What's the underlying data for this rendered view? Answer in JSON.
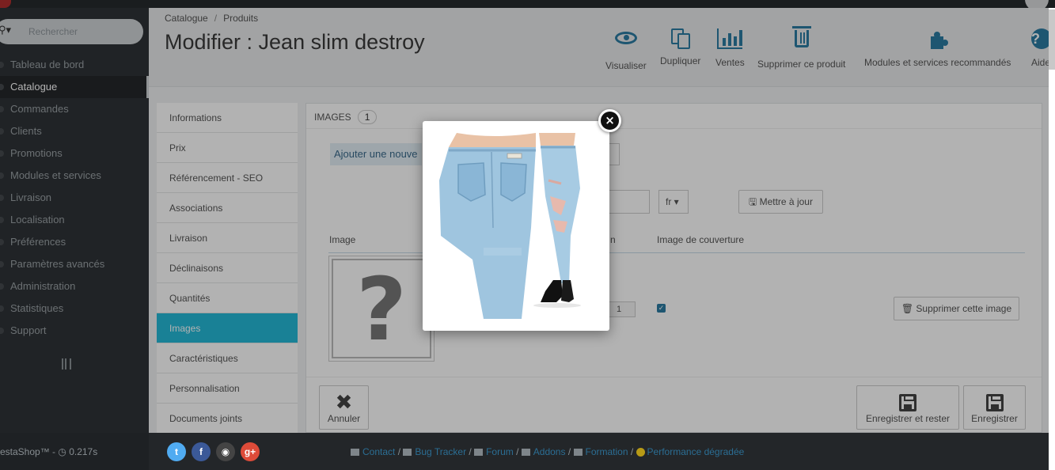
{
  "sidebar": {
    "search_placeholder": "Rechercher",
    "items": [
      {
        "label": "Tableau de bord"
      },
      {
        "label": "Catalogue",
        "active": true
      },
      {
        "label": "Commandes"
      },
      {
        "label": "Clients"
      },
      {
        "label": "Promotions"
      },
      {
        "label": "Modules et services"
      },
      {
        "label": "Livraison"
      },
      {
        "label": "Localisation"
      },
      {
        "label": "Préférences"
      },
      {
        "label": "Paramètres avancés"
      },
      {
        "label": "Administration"
      },
      {
        "label": "Statistiques"
      },
      {
        "label": "Support"
      }
    ]
  },
  "header": {
    "breadcrumb": [
      "Catalogue",
      "Produits"
    ],
    "breadcrumb_sep": "/",
    "title": "Modifier : Jean slim destroy",
    "toolbar": [
      {
        "label": "Visualiser",
        "icon": "eye-icon"
      },
      {
        "label": "Dupliquer",
        "icon": "copy-icon"
      },
      {
        "label": "Ventes",
        "icon": "bar-chart-icon"
      },
      {
        "label": "Supprimer ce produit",
        "icon": "trash-icon"
      },
      {
        "label": "Modules et services recommandés",
        "icon": "puzzle-icon"
      },
      {
        "label": "Aide",
        "icon": "help-icon"
      }
    ]
  },
  "tabs": [
    {
      "label": "Informations"
    },
    {
      "label": "Prix"
    },
    {
      "label": "Référencement - SEO"
    },
    {
      "label": "Associations"
    },
    {
      "label": "Livraison"
    },
    {
      "label": "Déclinaisons"
    },
    {
      "label": "Quantités"
    },
    {
      "label": "Images",
      "active": true
    },
    {
      "label": "Caractéristiques"
    },
    {
      "label": "Personnalisation"
    },
    {
      "label": "Documents joints"
    }
  ],
  "images_panel": {
    "heading": "Images",
    "count": "1",
    "add_button": "Ajouter une nouve",
    "language": "fr",
    "update_button": "Mettre à jour",
    "col_image": "Image",
    "col_position": "n",
    "col_cover": "Image de couverture",
    "placeholder_glyph": "?",
    "row_position": "1",
    "cover_checked": true,
    "delete_image_button": "Supprimer cette image",
    "cancel_button": "Annuler",
    "save_stay_button": "Enregistrer et rester",
    "save_button": "Enregistrer"
  },
  "modal": {
    "close_glyph": "×"
  },
  "footer": {
    "brand": "estaShop™ - ",
    "timing": "0.217s",
    "links": [
      {
        "label": "Contact",
        "sep": " / "
      },
      {
        "label": "Bug Tracker",
        "sep": " / "
      },
      {
        "label": "Forum",
        "sep": " / "
      },
      {
        "label": "Addons",
        "sep": " / "
      },
      {
        "label": "Formation",
        "sep": " / "
      },
      {
        "label": "Performance dégradée",
        "sep": ""
      }
    ],
    "social": [
      {
        "name": "twitter-icon",
        "glyph": "t",
        "color": "#50abf1"
      },
      {
        "name": "facebook-icon",
        "glyph": "f",
        "color": "#3b5998"
      },
      {
        "name": "github-icon",
        "glyph": "◉",
        "color": "#444444"
      },
      {
        "name": "google-plus-icon",
        "glyph": "g+",
        "color": "#dd4b39"
      }
    ]
  },
  "colors": {
    "accent": "#25b9d7",
    "toolbar_icons": "#2b7ba3",
    "sidebar_bg": "#2f3337"
  }
}
